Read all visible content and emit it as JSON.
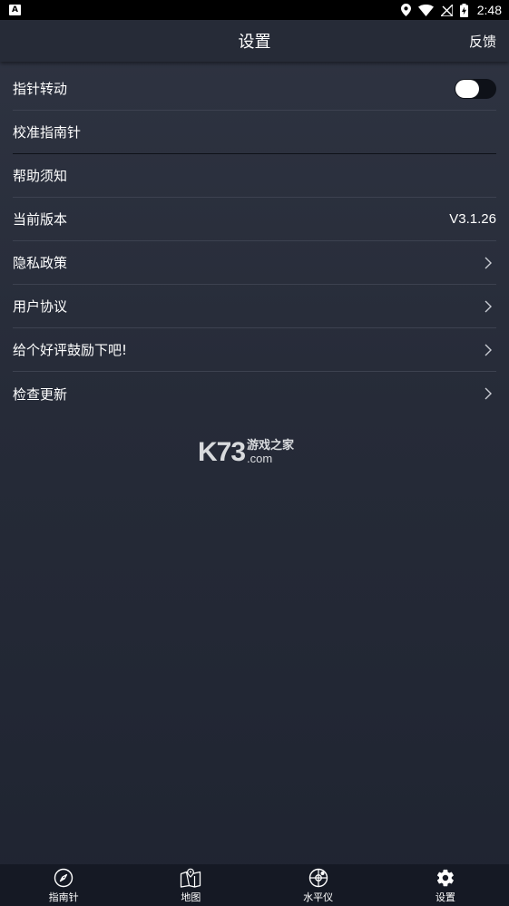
{
  "status_bar": {
    "notification_glyph": "A",
    "time": "2:48",
    "icons": [
      "location-icon",
      "wifi-icon",
      "no-signal-icon",
      "battery-charging-icon"
    ]
  },
  "header": {
    "title": "设置",
    "feedback_label": "反馈"
  },
  "settings": {
    "items": [
      {
        "label": "指针转动",
        "control": "toggle",
        "toggle_on": false
      },
      {
        "label": "校准指南针"
      },
      {
        "label": "帮助须知"
      },
      {
        "label": "当前版本",
        "value": "V3.1.26"
      },
      {
        "label": "隐私政策",
        "control": "chevron"
      },
      {
        "label": "用户协议",
        "control": "chevron"
      },
      {
        "label": "给个好评鼓励下吧!",
        "control": "chevron"
      },
      {
        "label": "检查更新",
        "control": "chevron"
      }
    ]
  },
  "watermark": {
    "brand": "K73",
    "cn_text": "游戏之家",
    "domain": ".com"
  },
  "tab_bar": {
    "tabs": [
      {
        "label": "指南针",
        "icon": "compass-icon"
      },
      {
        "label": "地图",
        "icon": "map-icon"
      },
      {
        "label": "水平仪",
        "icon": "level-icon"
      },
      {
        "label": "设置",
        "icon": "gear-icon",
        "active": true
      }
    ]
  }
}
